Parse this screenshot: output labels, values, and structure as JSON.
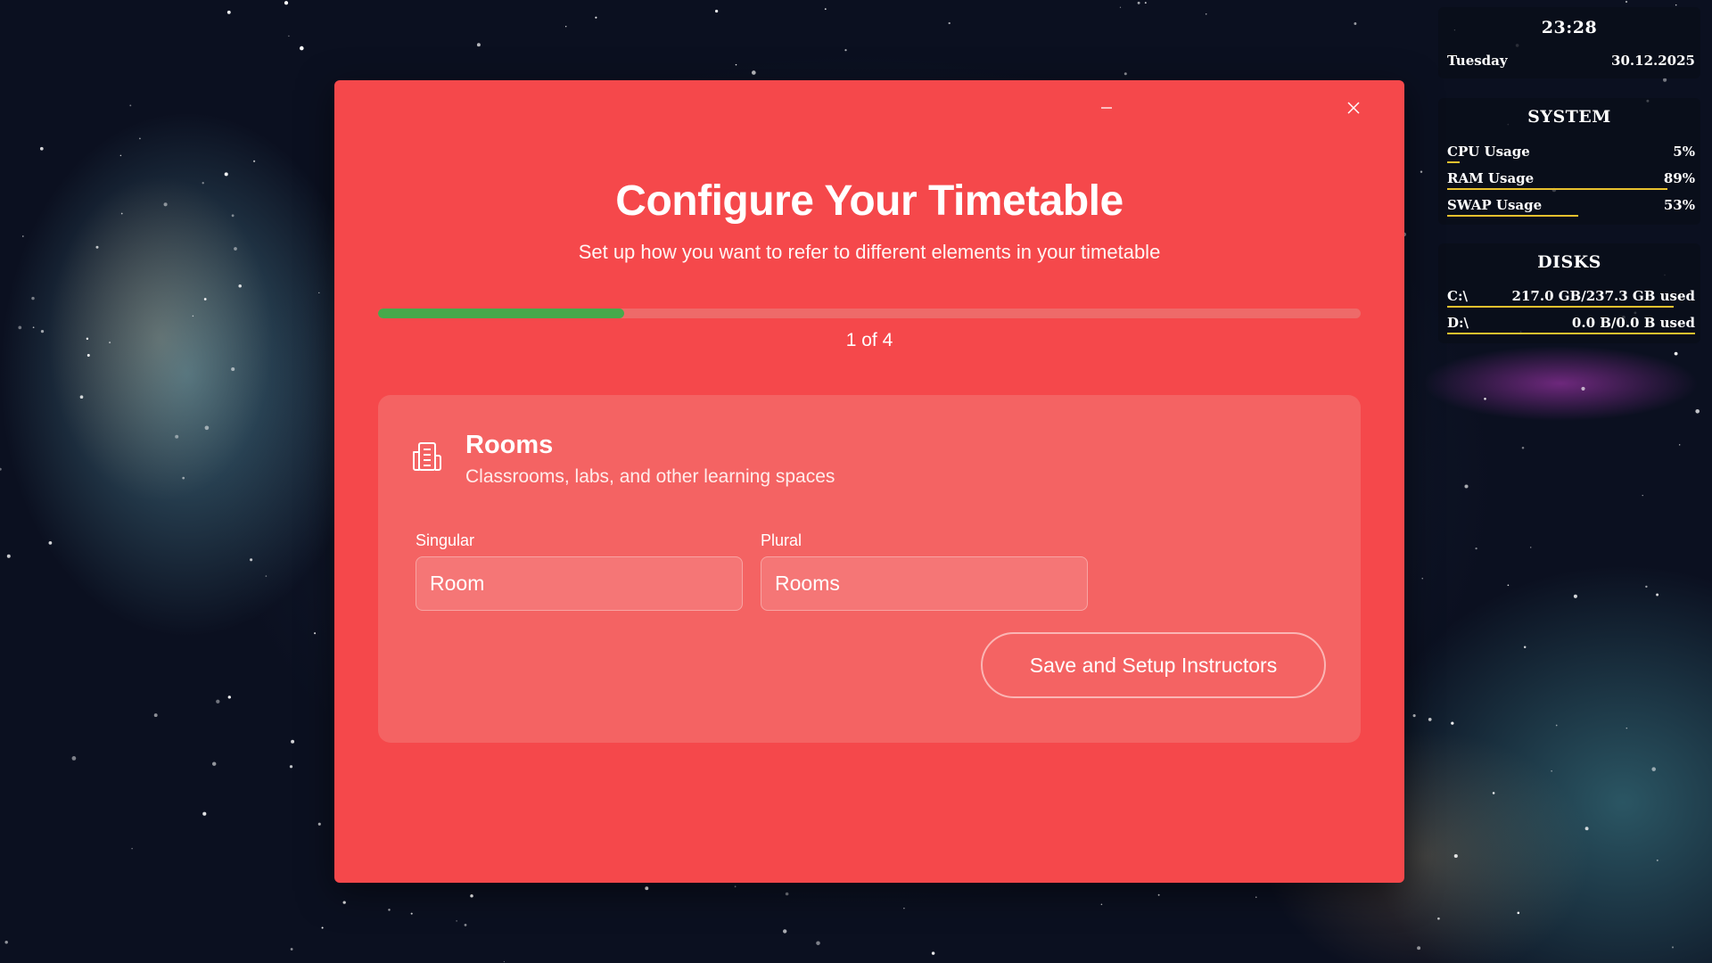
{
  "dialog": {
    "title": "Configure Your Timetable",
    "subtitle": "Set up how you want to refer to different elements in your timetable",
    "progress": {
      "current": 1,
      "total": 4,
      "fraction": 0.25,
      "label": "1 of 4"
    },
    "window_controls": {
      "minimize_icon": "minimize-icon",
      "close_icon": "close-icon"
    },
    "card": {
      "icon": "building-icon",
      "title": "Rooms",
      "description": "Classrooms, labs, and other learning spaces",
      "singular": {
        "label": "Singular",
        "value": "Room"
      },
      "plural": {
        "label": "Plural",
        "value": "Rooms"
      },
      "save_button": "Save and Setup Instructors"
    },
    "colors": {
      "background": "#f5484b",
      "card": "#f46363",
      "progress": "#46a94b"
    }
  },
  "widgets": {
    "clock": {
      "time": "23:28",
      "day": "Tuesday",
      "date": "30.12.2025"
    },
    "system": {
      "heading": "SYSTEM",
      "rows": [
        {
          "label": "CPU Usage",
          "value": "5%",
          "fraction": 0.05
        },
        {
          "label": "RAM Usage",
          "value": "89%",
          "fraction": 0.89
        },
        {
          "label": "SWAP Usage",
          "value": "53%",
          "fraction": 0.53
        }
      ]
    },
    "disks": {
      "heading": "DISKS",
      "rows": [
        {
          "label": "C:\\",
          "value": "217.0 GB/237.3 GB used",
          "fraction": 0.914
        },
        {
          "label": "D:\\",
          "value": "0.0 B/0.0 B used",
          "fraction": 1.0
        }
      ]
    },
    "accent": "#e8c12e"
  }
}
